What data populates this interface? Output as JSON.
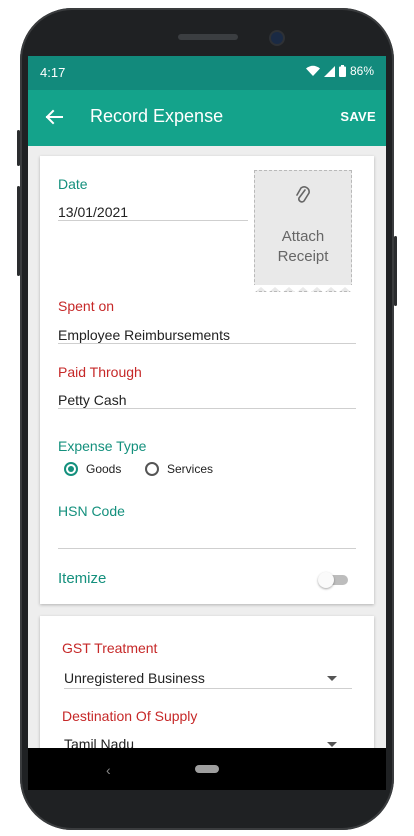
{
  "status_bar": {
    "time": "4:17",
    "battery": "86%"
  },
  "app_bar": {
    "title": "Record Expense",
    "save_label": "SAVE"
  },
  "form": {
    "date": {
      "label": "Date",
      "value": "13/01/2021"
    },
    "attach_receipt": {
      "line1": "Attach",
      "line2": "Receipt"
    },
    "spent_on": {
      "label": "Spent on",
      "value": "Employee Reimbursements"
    },
    "paid_through": {
      "label": "Paid Through",
      "value": "Petty Cash"
    },
    "expense_type": {
      "label": "Expense Type",
      "options": [
        "Goods",
        "Services"
      ],
      "selected": "Goods"
    },
    "hsn_code": {
      "label": "HSN Code",
      "value": ""
    },
    "itemize": {
      "label": "Itemize",
      "enabled": false
    }
  },
  "gst": {
    "treatment": {
      "label": "GST Treatment",
      "value": "Unregistered Business"
    },
    "destination": {
      "label": "Destination Of Supply",
      "value": "Tamil Nadu"
    }
  },
  "colors": {
    "status_bar": "#128a7c",
    "app_bar": "#14a38b",
    "accent_green": "#14907d",
    "required_red": "#c62828"
  },
  "icons": [
    "arrow-left-icon",
    "wifi-icon",
    "signal-icon",
    "battery-icon",
    "paperclip-icon",
    "chevron-down-icon",
    "nav-back-icon",
    "nav-home-icon"
  ]
}
